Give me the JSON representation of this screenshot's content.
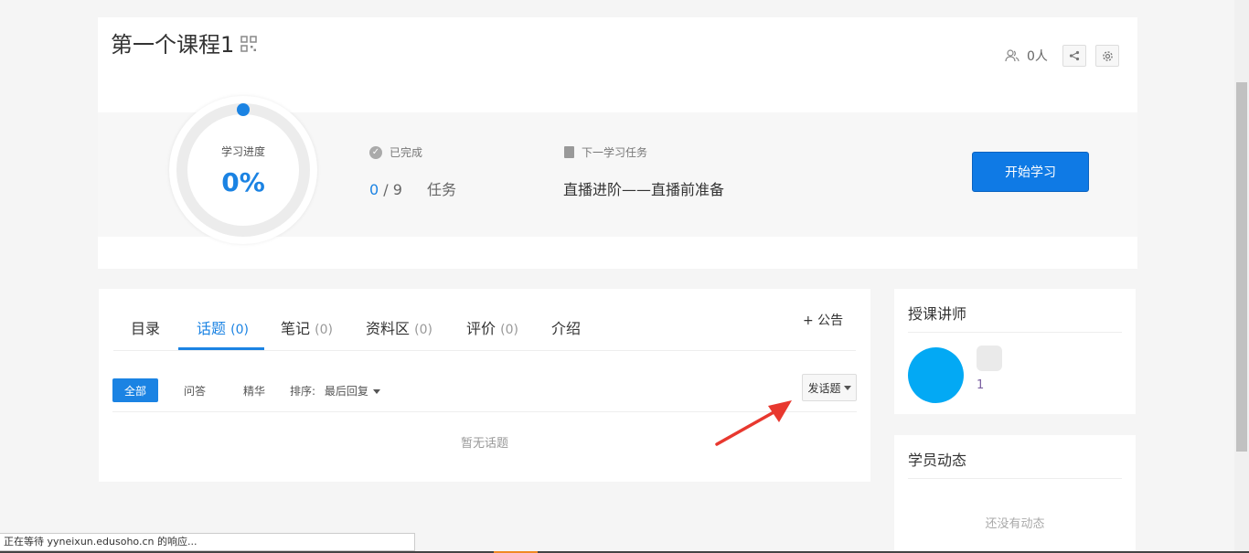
{
  "course": {
    "title": "第一个课程1",
    "members": "0人",
    "progress_label": "学习进度",
    "progress_value": "0%",
    "progress_fraction": 0,
    "completed_label": "已完成",
    "tasks_done": "0",
    "tasks_sep": " / ",
    "tasks_total": "9",
    "tasks_unit": "任务",
    "next_label": "下一学习任务",
    "next_task": "直播进阶——直播前准备",
    "start_button": "开始学习"
  },
  "tabs": [
    {
      "label": "目录",
      "count": ""
    },
    {
      "label": "话题",
      "count": "(0)"
    },
    {
      "label": "笔记",
      "count": "(0)"
    },
    {
      "label": "资料区",
      "count": "(0)"
    },
    {
      "label": "评价",
      "count": "(0)"
    },
    {
      "label": "介绍",
      "count": ""
    }
  ],
  "notice": {
    "icon": "plus-icon",
    "label": "+ 公告"
  },
  "filters": {
    "all": "全部",
    "qa": "问答",
    "elite": "精华",
    "sort_label": "排序:",
    "sort_value": "最后回复",
    "post_button": "发话题"
  },
  "empty_topics": "暂无话题",
  "sidebar": {
    "teacher_title": "授课讲师",
    "teacher_num": "1",
    "feed_title": "学员动态",
    "feed_empty": "还没有动态"
  },
  "status_bar": "正在等待 yyneixun.edusoho.cn 的响应...",
  "colors": {
    "accent": "#1b83e3",
    "avatar": "#03a9f4",
    "arrow": "#e8382f"
  }
}
